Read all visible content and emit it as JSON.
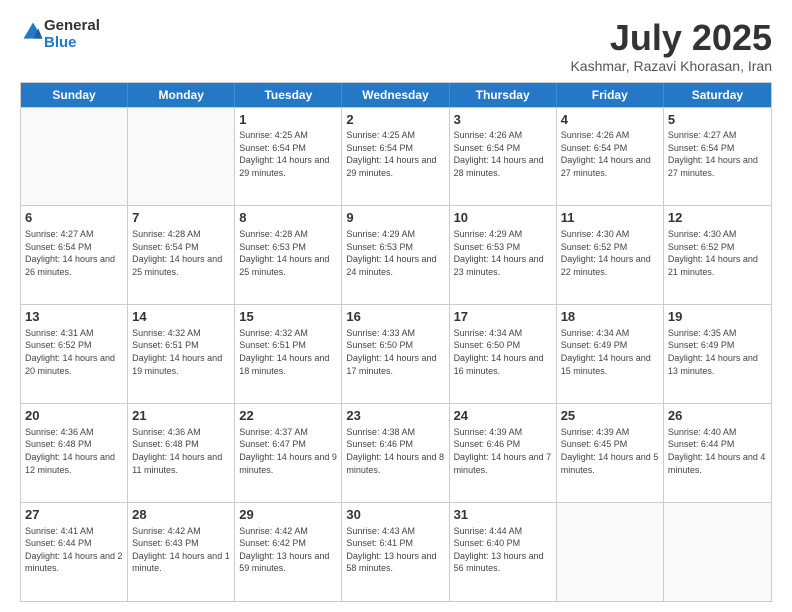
{
  "header": {
    "logo": {
      "line1": "General",
      "line2": "Blue"
    },
    "title": "July 2025",
    "location": "Kashmar, Razavi Khorasan, Iran"
  },
  "days_of_week": [
    "Sunday",
    "Monday",
    "Tuesday",
    "Wednesday",
    "Thursday",
    "Friday",
    "Saturday"
  ],
  "weeks": [
    [
      {
        "day": "",
        "empty": true
      },
      {
        "day": "",
        "empty": true
      },
      {
        "day": "1",
        "sunrise": "4:25 AM",
        "sunset": "6:54 PM",
        "daylight": "14 hours and 29 minutes."
      },
      {
        "day": "2",
        "sunrise": "4:25 AM",
        "sunset": "6:54 PM",
        "daylight": "14 hours and 29 minutes."
      },
      {
        "day": "3",
        "sunrise": "4:26 AM",
        "sunset": "6:54 PM",
        "daylight": "14 hours and 28 minutes."
      },
      {
        "day": "4",
        "sunrise": "4:26 AM",
        "sunset": "6:54 PM",
        "daylight": "14 hours and 27 minutes."
      },
      {
        "day": "5",
        "sunrise": "4:27 AM",
        "sunset": "6:54 PM",
        "daylight": "14 hours and 27 minutes."
      }
    ],
    [
      {
        "day": "6",
        "sunrise": "4:27 AM",
        "sunset": "6:54 PM",
        "daylight": "14 hours and 26 minutes."
      },
      {
        "day": "7",
        "sunrise": "4:28 AM",
        "sunset": "6:54 PM",
        "daylight": "14 hours and 25 minutes."
      },
      {
        "day": "8",
        "sunrise": "4:28 AM",
        "sunset": "6:53 PM",
        "daylight": "14 hours and 25 minutes."
      },
      {
        "day": "9",
        "sunrise": "4:29 AM",
        "sunset": "6:53 PM",
        "daylight": "14 hours and 24 minutes."
      },
      {
        "day": "10",
        "sunrise": "4:29 AM",
        "sunset": "6:53 PM",
        "daylight": "14 hours and 23 minutes."
      },
      {
        "day": "11",
        "sunrise": "4:30 AM",
        "sunset": "6:52 PM",
        "daylight": "14 hours and 22 minutes."
      },
      {
        "day": "12",
        "sunrise": "4:30 AM",
        "sunset": "6:52 PM",
        "daylight": "14 hours and 21 minutes."
      }
    ],
    [
      {
        "day": "13",
        "sunrise": "4:31 AM",
        "sunset": "6:52 PM",
        "daylight": "14 hours and 20 minutes."
      },
      {
        "day": "14",
        "sunrise": "4:32 AM",
        "sunset": "6:51 PM",
        "daylight": "14 hours and 19 minutes."
      },
      {
        "day": "15",
        "sunrise": "4:32 AM",
        "sunset": "6:51 PM",
        "daylight": "14 hours and 18 minutes."
      },
      {
        "day": "16",
        "sunrise": "4:33 AM",
        "sunset": "6:50 PM",
        "daylight": "14 hours and 17 minutes."
      },
      {
        "day": "17",
        "sunrise": "4:34 AM",
        "sunset": "6:50 PM",
        "daylight": "14 hours and 16 minutes."
      },
      {
        "day": "18",
        "sunrise": "4:34 AM",
        "sunset": "6:49 PM",
        "daylight": "14 hours and 15 minutes."
      },
      {
        "day": "19",
        "sunrise": "4:35 AM",
        "sunset": "6:49 PM",
        "daylight": "14 hours and 13 minutes."
      }
    ],
    [
      {
        "day": "20",
        "sunrise": "4:36 AM",
        "sunset": "6:48 PM",
        "daylight": "14 hours and 12 minutes."
      },
      {
        "day": "21",
        "sunrise": "4:36 AM",
        "sunset": "6:48 PM",
        "daylight": "14 hours and 11 minutes."
      },
      {
        "day": "22",
        "sunrise": "4:37 AM",
        "sunset": "6:47 PM",
        "daylight": "14 hours and 9 minutes."
      },
      {
        "day": "23",
        "sunrise": "4:38 AM",
        "sunset": "6:46 PM",
        "daylight": "14 hours and 8 minutes."
      },
      {
        "day": "24",
        "sunrise": "4:39 AM",
        "sunset": "6:46 PM",
        "daylight": "14 hours and 7 minutes."
      },
      {
        "day": "25",
        "sunrise": "4:39 AM",
        "sunset": "6:45 PM",
        "daylight": "14 hours and 5 minutes."
      },
      {
        "day": "26",
        "sunrise": "4:40 AM",
        "sunset": "6:44 PM",
        "daylight": "14 hours and 4 minutes."
      }
    ],
    [
      {
        "day": "27",
        "sunrise": "4:41 AM",
        "sunset": "6:44 PM",
        "daylight": "14 hours and 2 minutes."
      },
      {
        "day": "28",
        "sunrise": "4:42 AM",
        "sunset": "6:43 PM",
        "daylight": "14 hours and 1 minute."
      },
      {
        "day": "29",
        "sunrise": "4:42 AM",
        "sunset": "6:42 PM",
        "daylight": "13 hours and 59 minutes."
      },
      {
        "day": "30",
        "sunrise": "4:43 AM",
        "sunset": "6:41 PM",
        "daylight": "13 hours and 58 minutes."
      },
      {
        "day": "31",
        "sunrise": "4:44 AM",
        "sunset": "6:40 PM",
        "daylight": "13 hours and 56 minutes."
      },
      {
        "day": "",
        "empty": true
      },
      {
        "day": "",
        "empty": true
      }
    ]
  ]
}
